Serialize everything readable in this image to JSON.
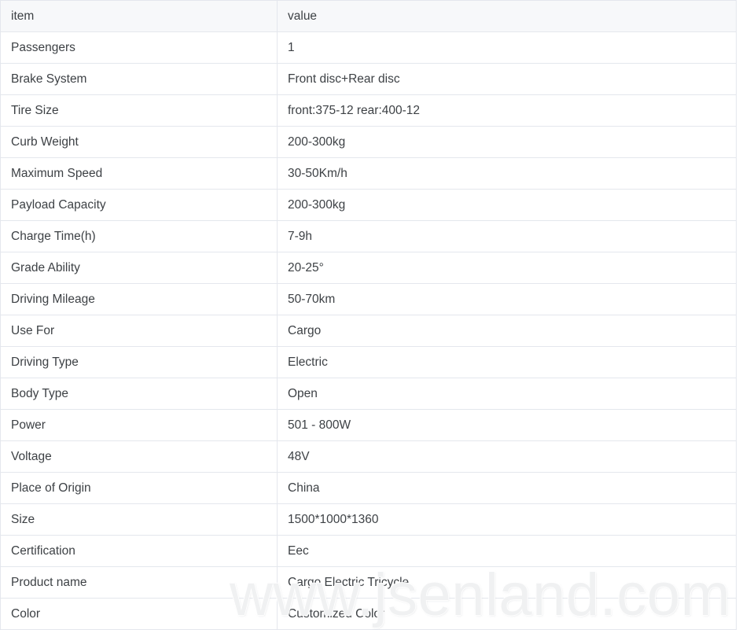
{
  "table": {
    "headers": [
      "item",
      "value"
    ],
    "rows": [
      {
        "item": "Passengers",
        "value": "1"
      },
      {
        "item": "Brake System",
        "value": "Front disc+Rear disc"
      },
      {
        "item": "Tire Size",
        "value": "front:375-12 rear:400-12"
      },
      {
        "item": "Curb Weight",
        "value": "200-300kg"
      },
      {
        "item": "Maximum Speed",
        "value": "30-50Km/h"
      },
      {
        "item": "Payload Capacity",
        "value": "200-300kg"
      },
      {
        "item": "Charge Time(h)",
        "value": "7-9h"
      },
      {
        "item": "Grade Ability",
        "value": "20-25°"
      },
      {
        "item": "Driving Mileage",
        "value": "50-70km"
      },
      {
        "item": "Use For",
        "value": "Cargo"
      },
      {
        "item": "Driving Type",
        "value": "Electric"
      },
      {
        "item": "Body Type",
        "value": "Open"
      },
      {
        "item": "Power",
        "value": "501 - 800W"
      },
      {
        "item": "Voltage",
        "value": "48V"
      },
      {
        "item": "Place of Origin",
        "value": "China"
      },
      {
        "item": "Size",
        "value": "1500*1000*1360"
      },
      {
        "item": "Certification",
        "value": "Eec"
      },
      {
        "item": "Product name",
        "value": "Cargo Electric Tricycle"
      },
      {
        "item": "Color",
        "value": "Customized Color"
      }
    ]
  },
  "watermark": {
    "text": "www.jsenland.com"
  },
  "colors": {
    "header_background": "#f7f8fa",
    "row_background": "#ffffff",
    "border": "#e4e7ed",
    "text": "#3d4145",
    "watermark": "#f0f1f2"
  }
}
